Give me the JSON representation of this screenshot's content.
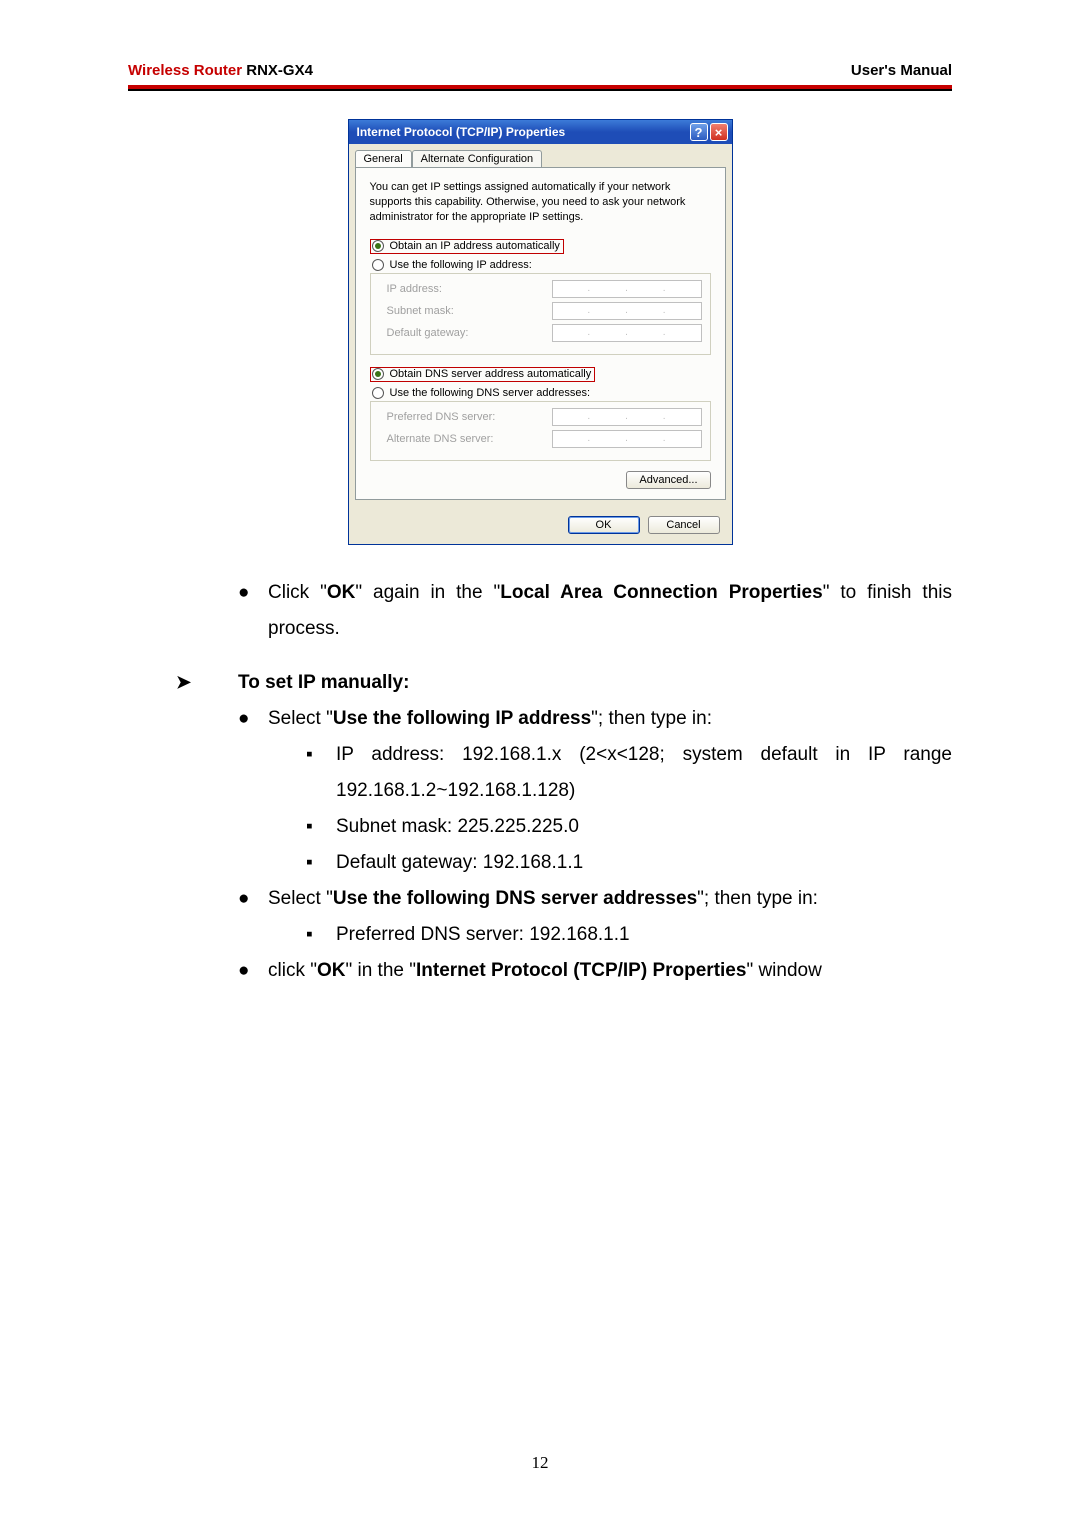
{
  "header": {
    "product_red": "Wireless Router",
    "product_model": " RNX-GX4",
    "right": "User's Manual"
  },
  "dialog": {
    "title": "Internet Protocol (TCP/IP) Properties",
    "tabs": {
      "general": "General",
      "alt": "Alternate Configuration"
    },
    "desc": "You can get IP settings assigned automatically if your network supports this capability. Otherwise, you need to ask your network administrator for the appropriate IP settings.",
    "radio_ip_auto": "Obtain an IP address automatically",
    "radio_ip_manual": "Use the following IP address:",
    "fields": {
      "ip": "IP address:",
      "mask": "Subnet mask:",
      "gw": "Default gateway:"
    },
    "radio_dns_auto": "Obtain DNS server address automatically",
    "radio_dns_manual": "Use the following DNS server addresses:",
    "dns_fields": {
      "pref": "Preferred DNS server:",
      "alt": "Alternate DNS server:"
    },
    "advanced": "Advanced...",
    "ok": "OK",
    "cancel": "Cancel"
  },
  "manual": {
    "step_click_ok_prefix": "Click \"",
    "ok": "OK",
    "step_click_ok_mid": "\" again in the \"",
    "lac_props": "Local Area Connection Properties",
    "step_click_ok_suffix": "\" to finish this process.",
    "to_set_ip": "To set IP manually:",
    "select_prefix": "Select \"",
    "use_following_ip": "Use the following IP address",
    "select_suffix": "\"; then type in:",
    "ip_line": "IP address: 192.168.1.x (2<x<128; system default in IP range 192.168.1.2~192.168.1.128)",
    "mask_line": "Subnet mask: 225.225.225.0",
    "gw_line": "Default gateway: 192.168.1.1",
    "use_following_dns": "Use the following DNS server addresses",
    "pref_dns_line": "Preferred DNS server: 192.168.1.1",
    "click_lower": "click \"",
    "in_the": "\" in the \"",
    "tcpip_props": "Internet Protocol (TCP/IP) Properties",
    "window_suffix": "\" window",
    "page_number": "12"
  }
}
